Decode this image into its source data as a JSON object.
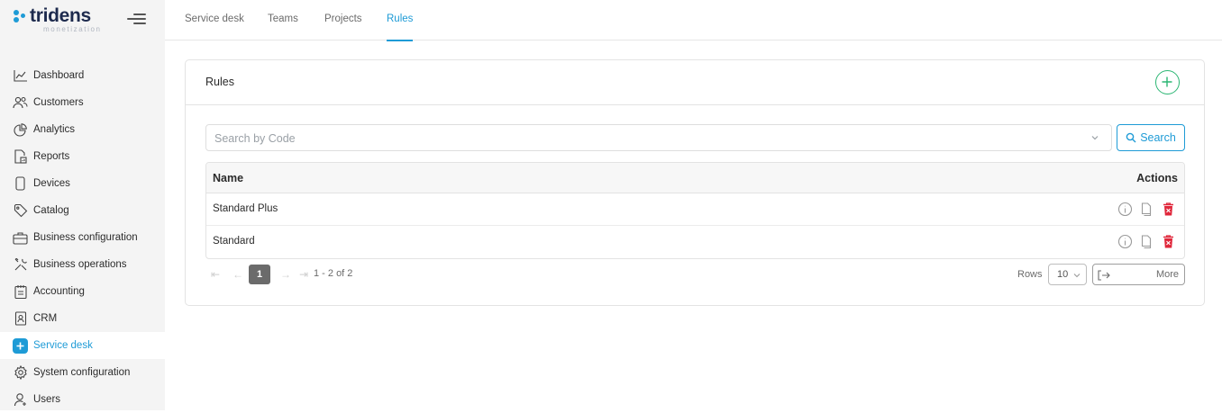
{
  "brand": {
    "name": "tridens",
    "tagline": "monetization",
    "color": "#1e9bd6"
  },
  "sidebar": {
    "items": [
      {
        "label": "Dashboard",
        "icon": "chart-line-icon"
      },
      {
        "label": "Customers",
        "icon": "users-icon"
      },
      {
        "label": "Analytics",
        "icon": "pie-chart-icon"
      },
      {
        "label": "Reports",
        "icon": "report-icon"
      },
      {
        "label": "Devices",
        "icon": "device-icon"
      },
      {
        "label": "Catalog",
        "icon": "tag-icon"
      },
      {
        "label": "Business configuration",
        "icon": "briefcase-icon"
      },
      {
        "label": "Business operations",
        "icon": "tools-icon"
      },
      {
        "label": "Accounting",
        "icon": "clipboard-icon"
      },
      {
        "label": "CRM",
        "icon": "contact-icon"
      },
      {
        "label": "Service desk",
        "icon": "plus-icon",
        "active": true
      },
      {
        "label": "System configuration",
        "icon": "gear-icon"
      },
      {
        "label": "Users",
        "icon": "user-icon"
      }
    ]
  },
  "tabs": [
    {
      "label": "Service desk"
    },
    {
      "label": "Teams"
    },
    {
      "label": "Projects"
    },
    {
      "label": "Rules",
      "active": true
    }
  ],
  "card": {
    "title": "Rules",
    "search": {
      "placeholder": "Search by Code",
      "value": "",
      "button_label": "Search"
    },
    "table": {
      "headers": {
        "name": "Name",
        "actions": "Actions"
      },
      "rows": [
        {
          "name": "Standard Plus"
        },
        {
          "name": "Standard"
        }
      ]
    },
    "pagination": {
      "current_page": "1",
      "range": "1 - 2 of 2",
      "rows_label": "Rows",
      "rows_per_page": "10",
      "more_label": "More"
    }
  },
  "colors": {
    "accent": "#1e9bd6",
    "add": "#2bb673",
    "delete": "#e0263a"
  }
}
